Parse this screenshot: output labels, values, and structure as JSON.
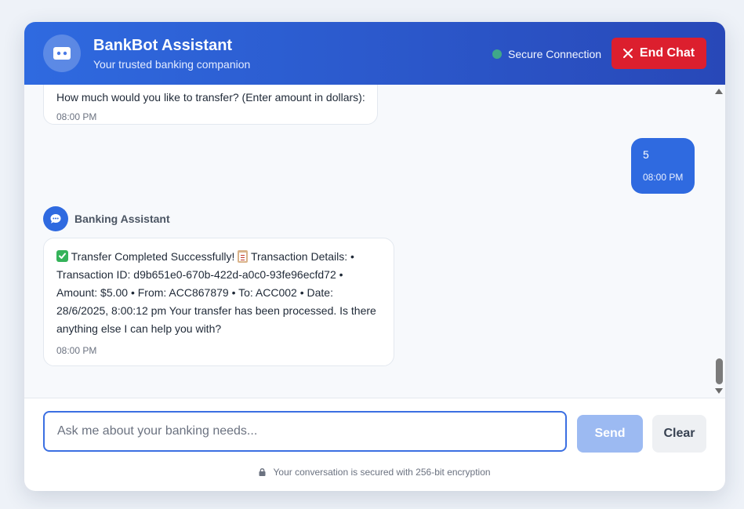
{
  "header": {
    "title": "BankBot Assistant",
    "subtitle": "Your trusted banking companion",
    "status": "Secure Connection",
    "end_chat_label": "End Chat"
  },
  "messages": [
    {
      "sender": "bot",
      "text": "How much would you like to transfer? (Enter amount in dollars):",
      "time": "08:00 PM"
    },
    {
      "sender": "user",
      "text": "5",
      "time": "08:00 PM"
    },
    {
      "sender": "bot",
      "sender_name": "Banking Assistant",
      "text_part1": "Transfer Completed Successfully!",
      "text_part2": "Transaction Details: • Transaction ID: d9b651e0-670b-422d-a0c0-93fe96ecfd72 • Amount: $5.00 • From: ACC867879 • To: ACC002 • Date: 28/6/2025, 8:00:12 pm Your transfer has been processed. Is there anything else I can help you with?",
      "time": "08:00 PM"
    }
  ],
  "input": {
    "placeholder": "Ask me about your banking needs...",
    "value": ""
  },
  "send_label": "Send",
  "clear_label": "Clear",
  "footer_text": "Your conversation is secured with 256-bit encryption",
  "colors": {
    "primary": "#2f6ae0",
    "danger": "#dc1f2e",
    "status_dot": "#3fa889"
  },
  "icons": [
    "wallet-icon",
    "close-icon",
    "chat-bubble-icon",
    "check-emoji-icon",
    "clipboard-emoji-icon",
    "lock-icon"
  ]
}
